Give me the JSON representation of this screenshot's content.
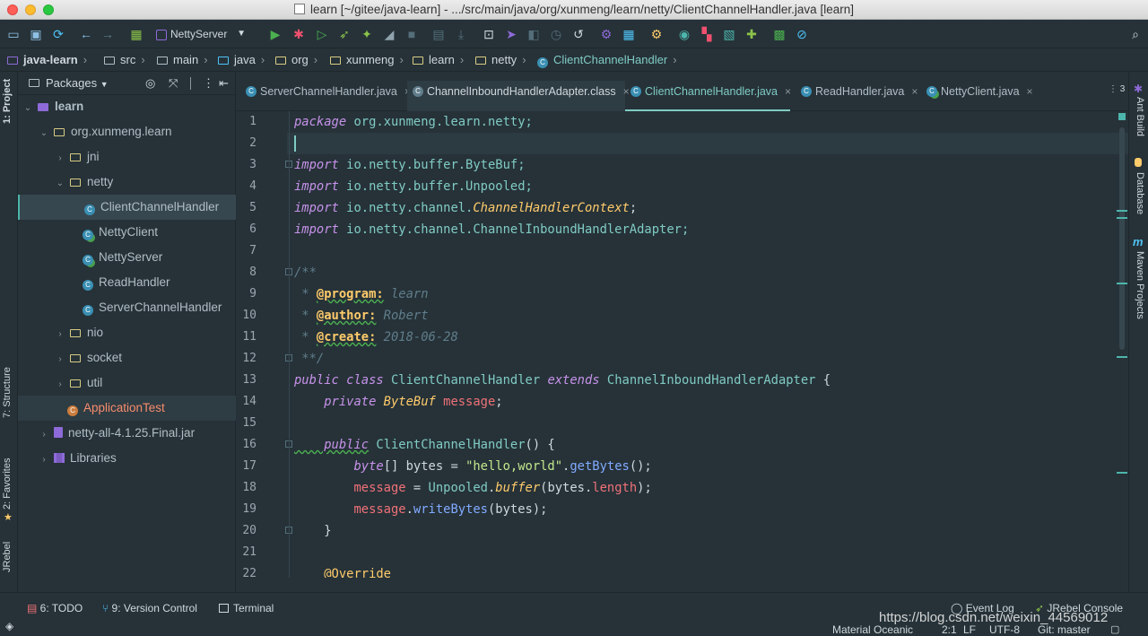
{
  "window": {
    "title": "learn [~/gitee/java-learn] - .../src/main/java/org/xunmeng/learn/netty/ClientChannelHandler.java [learn]"
  },
  "toolbar": {
    "run_config": "NettyServer"
  },
  "breadcrumb": {
    "items": [
      "java-learn",
      "src",
      "main",
      "java",
      "org",
      "xunmeng",
      "learn",
      "netty",
      "ClientChannelHandler"
    ]
  },
  "left_strip": {
    "project": "1: Project",
    "structure": "7: Structure",
    "favorites": "2: Favorites",
    "jrebel": "JRebel"
  },
  "project_panel": {
    "view": "Packages",
    "tree": [
      {
        "label": "learn",
        "kind": "module"
      },
      {
        "label": "org.xunmeng.learn",
        "kind": "package"
      },
      {
        "label": "jni",
        "kind": "package"
      },
      {
        "label": "netty",
        "kind": "package"
      },
      {
        "label": "ClientChannelHandler",
        "kind": "class"
      },
      {
        "label": "NettyClient",
        "kind": "class"
      },
      {
        "label": "NettyServer",
        "kind": "class"
      },
      {
        "label": "ReadHandler",
        "kind": "class"
      },
      {
        "label": "ServerChannelHandler",
        "kind": "class"
      },
      {
        "label": "nio",
        "kind": "package"
      },
      {
        "label": "socket",
        "kind": "package"
      },
      {
        "label": "util",
        "kind": "package"
      },
      {
        "label": "ApplicationTest",
        "kind": "class"
      },
      {
        "label": "netty-all-4.1.25.Final.jar",
        "kind": "jar"
      },
      {
        "label": "Libraries",
        "kind": "library"
      }
    ]
  },
  "tabs": [
    {
      "label": "ServerChannelHandler.java"
    },
    {
      "label": "ChannelInboundHandlerAdapter.class"
    },
    {
      "label": "ClientChannelHandler.java"
    },
    {
      "label": "ReadHandler.java"
    },
    {
      "label": "NettyClient.java"
    }
  ],
  "tab_overflow_count": "3",
  "editor": {
    "line_numbers": [
      "1",
      "2",
      "3",
      "4",
      "5",
      "6",
      "7",
      "8",
      "9",
      "10",
      "11",
      "12",
      "13",
      "14",
      "15",
      "16",
      "17",
      "18",
      "19",
      "20",
      "21",
      "22"
    ],
    "lines": {
      "l1a": "package",
      "l1b": " org.xunmeng.learn.netty;",
      "l3a": "import",
      "l3b": " io.netty.buffer.ByteBuf;",
      "l4a": "import",
      "l4b": " io.netty.buffer.Unpooled;",
      "l5a": "import",
      "l5b": " io.netty.channel.",
      "l5c": "ChannelHandlerContext",
      "l5d": ";",
      "l6a": "import",
      "l6b": " io.netty.channel.ChannelInboundHandlerAdapter;",
      "l8": "/**",
      "l9a": " * ",
      "l9b": "@program:",
      "l9c": " learn",
      "l10a": " * ",
      "l10b": "@author:",
      "l10c": " Robert",
      "l11a": " * ",
      "l11b": "@create:",
      "l11c": " 2018-06-28",
      "l12": " **/",
      "l13a": "public class",
      "l13b": " ClientChannelHandler ",
      "l13c": "extends",
      "l13d": " ChannelInboundHandlerAdapter",
      "l13e": " {",
      "l14a": "    private",
      "l14b": " ByteBuf",
      "l14c": " message",
      "l14d": ";",
      "l16a": "    public",
      "l16b": " ClientChannelHandler",
      "l16c": "() {",
      "l17a": "        byte",
      "l17b": "[] bytes = ",
      "l17c": "\"hello,world\"",
      "l17d": ".",
      "l17e": "getBytes",
      "l17f": "();",
      "l18a": "        message",
      "l18b": " = ",
      "l18c": "Unpooled",
      "l18d": ".",
      "l18e": "buffer",
      "l18f": "(bytes.",
      "l18g": "length",
      "l18h": ");",
      "l19a": "        message",
      "l19b": ".",
      "l19c": "writeBytes",
      "l19d": "(bytes);",
      "l20": "    }",
      "l22": "    @Override"
    }
  },
  "right_strip": {
    "ant": "Ant Build",
    "database": "Database",
    "maven": "Maven Projects"
  },
  "bottom_tools": {
    "todo": "6: TODO",
    "vcs": "9: Version Control",
    "terminal": "Terminal",
    "event_log": "Event Log",
    "jrebel_console": "JRebel Console"
  },
  "status_bar": {
    "theme": "Material Oceanic",
    "position": "2:1",
    "line_sep": "LF",
    "encoding": "UTF-8",
    "git": "Git: master"
  },
  "watermark": "https://blog.csdn.net/weixin_44569012"
}
